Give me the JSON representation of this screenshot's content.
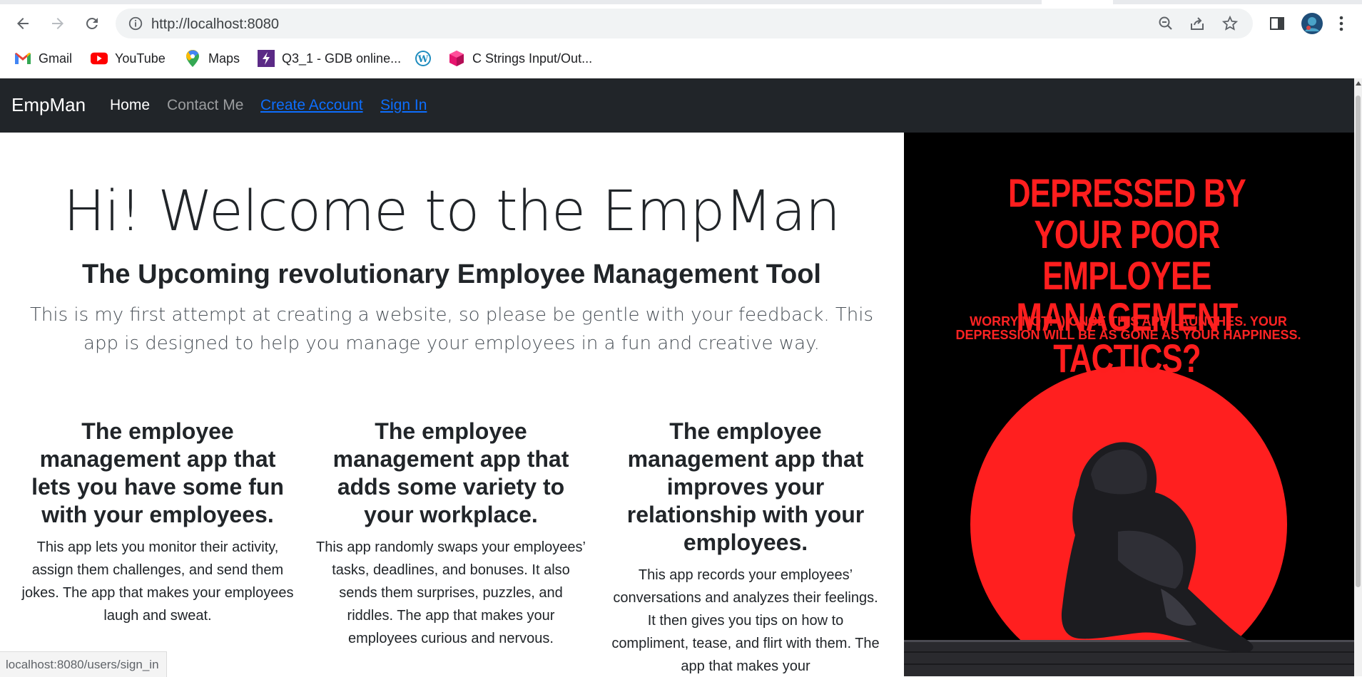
{
  "browser": {
    "url": "http://localhost:8080",
    "bookmarks": [
      {
        "label": "Gmail",
        "icon": "gmail-icon"
      },
      {
        "label": "YouTube",
        "icon": "youtube-icon"
      },
      {
        "label": "Maps",
        "icon": "maps-icon"
      },
      {
        "label": "Q3_1 - GDB online...",
        "icon": "gdb-icon"
      },
      {
        "label": "",
        "icon": "wordpress-icon"
      },
      {
        "label": "C Strings Input/Out...",
        "icon": "cube-icon"
      }
    ],
    "status_url": "localhost:8080/users/sign_in"
  },
  "navbar": {
    "brand": "EmpMan",
    "links": {
      "home": "Home",
      "contact": "Contact Me",
      "create_account": "Create Account",
      "sign_in": "Sign In"
    }
  },
  "hero": {
    "title": "Hi! Welcome to the EmpMan",
    "subtitle": "The Upcoming revolutionary Employee Management Tool",
    "lead": "This is my first attempt at creating a website, so please be gentle with your feedback. This app is designed to help you manage your employees in a fun and creative way."
  },
  "features": [
    {
      "heading": "The employee management app that lets you have some fun with your employees.",
      "body": "This app lets you monitor their activity, assign them challenges, and send them jokes. The app that makes your employees laugh and sweat."
    },
    {
      "heading": "The employee management app that adds some variety to your workplace.",
      "body": "This app randomly swaps your employees’ tasks, deadlines, and bonuses. It also sends them surprises, puzzles, and riddles. The app that makes your employees curious and nervous."
    },
    {
      "heading": "The employee management app that improves your relationship with your employees.",
      "body": "This app records your employees’ conversations and analyzes their feelings. It then gives you tips on how to compliment, tease, and flirt with them. The app that makes your"
    }
  ],
  "ad": {
    "headline": "DEPRESSED BY YOUR POOR EMPLOYEE MANAGEMENT TACTICS?",
    "subline": "WORRY NOT! :) ONCE THIS APP LAUNCHES. YOUR DEPRESSION WILL BE AS GONE AS YOUR HAPPINESS."
  },
  "colors": {
    "navbar_bg": "#212529",
    "link_blue": "#0d6efd",
    "ad_red": "#ff1e1e",
    "ad_bg": "#000000"
  }
}
